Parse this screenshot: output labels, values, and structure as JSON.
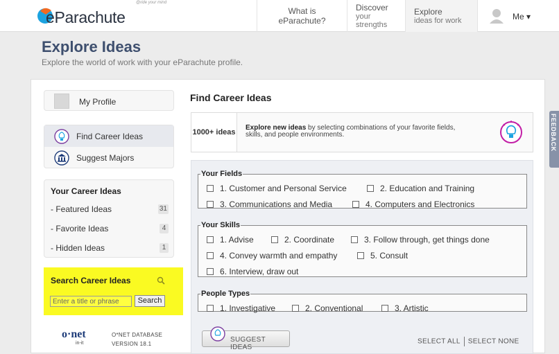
{
  "brand": {
    "name": "eParachute",
    "tagline": "@ride your mind",
    "accent": "#1ca3e0",
    "logo_orange": "#f26a21",
    "title_color": "#3e4f6e"
  },
  "nav": {
    "what": "What is eParachute?",
    "discover_top": "Discover",
    "discover_bottom": "your strengths",
    "explore_top": "Explore",
    "explore_bottom": "ideas for work",
    "me": "Me ▾"
  },
  "page": {
    "title": "Explore Ideas",
    "subtitle": "Explore the world of work with your eParachute profile."
  },
  "sidebar": {
    "profile": "My Profile",
    "find_ideas": "Find Career Ideas",
    "suggest_majors": "Suggest Majors",
    "career_head": "Your Career Ideas",
    "career_items": [
      {
        "label": "- Featured Ideas",
        "count": "31"
      },
      {
        "label": "- Favorite Ideas",
        "count": "4"
      },
      {
        "label": "- Hidden Ideas",
        "count": "1"
      }
    ],
    "search_head": "Search Career Ideas",
    "search_placeholder": "Enter a title or phrase",
    "search_button": "Search",
    "onet_logo": "o·net",
    "onet_sub": "in-it",
    "onet_line1": "O*NET DATABASE",
    "onet_line2": "VERSION 18.1"
  },
  "main": {
    "title": "Find Career Ideas",
    "count": "1000+ ideas",
    "desc_bold": "Explore new ideas",
    "desc_rest": " by selecting combinations of your favorite fields, skills, and people environments.",
    "fields_legend": "Your Fields",
    "fields": [
      "1. Customer and Personal Service",
      "2. Education and Training",
      "3. Communications and Media",
      "4. Computers and Electronics"
    ],
    "skills_legend": "Your Skills",
    "skills": [
      "1. Advise",
      "2. Coordinate",
      "3. Follow through, get things done",
      "4. Convey warmth and empathy",
      "5. Consult",
      "6. Interview, draw out"
    ],
    "people_legend": "People Types",
    "people": [
      "1. Investigative",
      "2. Conventional",
      "3. Artistic"
    ],
    "suggest_button": "SUGGEST IDEAS",
    "select_all": "SELECT ALL",
    "select_none": "SELECT NONE"
  },
  "feedback": "FEEDBACK"
}
